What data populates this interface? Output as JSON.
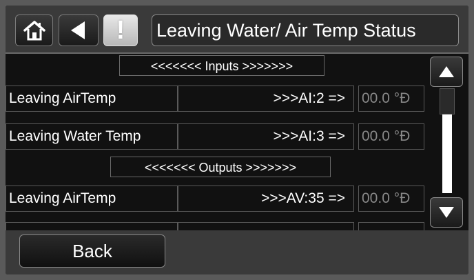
{
  "header": {
    "title": "Leaving Water/ Air Temp Status",
    "alert_symbol": "!",
    "icons": {
      "home": "home-icon",
      "back": "back-arrow-icon",
      "alert": "alert-icon"
    }
  },
  "sections": {
    "inputs": "<<<<<<< Inputs >>>>>>>",
    "outputs": "<<<<<<< Outputs >>>>>>>"
  },
  "rows": [
    {
      "label": "Leaving AirTemp",
      "source": ">>>AI:2 =>",
      "value": "00.0 °Ð"
    },
    {
      "label": "Leaving Water Temp",
      "source": ">>>AI:3 =>",
      "value": "00.0 °Ð"
    },
    {
      "label": "Leaving AirTemp",
      "source": ">>>AV:35 =>",
      "value": "00.0 °Ð"
    }
  ],
  "scrollbar": {
    "up": "scroll-up-icon",
    "down": "scroll-down-icon"
  },
  "footer": {
    "back_label": "Back"
  },
  "colors": {
    "background": "#111111",
    "header": "#3a3a3a",
    "border": "#8a8a8a",
    "value_text": "#888888",
    "text": "#ffffff"
  }
}
